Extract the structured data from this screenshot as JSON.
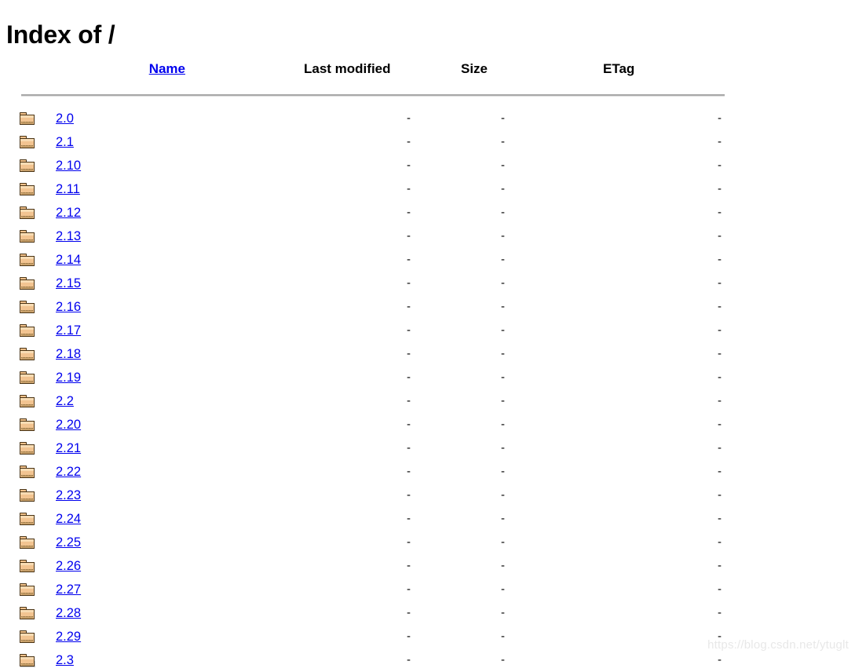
{
  "page": {
    "title": "Index of /",
    "watermark": "https://blog.csdn.net/ytuglt"
  },
  "table": {
    "headers": {
      "name": "Name",
      "last_modified": "Last modified",
      "size": "Size",
      "etag": "ETag"
    },
    "empty_value": "-",
    "rows": [
      {
        "icon": "folder-icon",
        "name": "2.0",
        "last_modified": "-",
        "size": "-",
        "etag": "-"
      },
      {
        "icon": "folder-icon",
        "name": "2.1",
        "last_modified": "-",
        "size": "-",
        "etag": "-"
      },
      {
        "icon": "folder-icon",
        "name": "2.10",
        "last_modified": "-",
        "size": "-",
        "etag": "-"
      },
      {
        "icon": "folder-icon",
        "name": "2.11",
        "last_modified": "-",
        "size": "-",
        "etag": "-"
      },
      {
        "icon": "folder-icon",
        "name": "2.12",
        "last_modified": "-",
        "size": "-",
        "etag": "-"
      },
      {
        "icon": "folder-icon",
        "name": "2.13",
        "last_modified": "-",
        "size": "-",
        "etag": "-"
      },
      {
        "icon": "folder-icon",
        "name": "2.14",
        "last_modified": "-",
        "size": "-",
        "etag": "-"
      },
      {
        "icon": "folder-icon",
        "name": "2.15",
        "last_modified": "-",
        "size": "-",
        "etag": "-"
      },
      {
        "icon": "folder-icon",
        "name": "2.16",
        "last_modified": "-",
        "size": "-",
        "etag": "-"
      },
      {
        "icon": "folder-icon",
        "name": "2.17",
        "last_modified": "-",
        "size": "-",
        "etag": "-"
      },
      {
        "icon": "folder-icon",
        "name": "2.18",
        "last_modified": "-",
        "size": "-",
        "etag": "-"
      },
      {
        "icon": "folder-icon",
        "name": "2.19",
        "last_modified": "-",
        "size": "-",
        "etag": "-"
      },
      {
        "icon": "folder-icon",
        "name": "2.2",
        "last_modified": "-",
        "size": "-",
        "etag": "-"
      },
      {
        "icon": "folder-icon",
        "name": "2.20",
        "last_modified": "-",
        "size": "-",
        "etag": "-"
      },
      {
        "icon": "folder-icon",
        "name": "2.21",
        "last_modified": "-",
        "size": "-",
        "etag": "-"
      },
      {
        "icon": "folder-icon",
        "name": "2.22",
        "last_modified": "-",
        "size": "-",
        "etag": "-"
      },
      {
        "icon": "folder-icon",
        "name": "2.23",
        "last_modified": "-",
        "size": "-",
        "etag": "-"
      },
      {
        "icon": "folder-icon",
        "name": "2.24",
        "last_modified": "-",
        "size": "-",
        "etag": "-"
      },
      {
        "icon": "folder-icon",
        "name": "2.25",
        "last_modified": "-",
        "size": "-",
        "etag": "-"
      },
      {
        "icon": "folder-icon",
        "name": "2.26",
        "last_modified": "-",
        "size": "-",
        "etag": "-"
      },
      {
        "icon": "folder-icon",
        "name": "2.27",
        "last_modified": "-",
        "size": "-",
        "etag": "-"
      },
      {
        "icon": "folder-icon",
        "name": "2.28",
        "last_modified": "-",
        "size": "-",
        "etag": "-"
      },
      {
        "icon": "folder-icon",
        "name": "2.29",
        "last_modified": "-",
        "size": "-",
        "etag": "-"
      },
      {
        "icon": "folder-icon",
        "name": "2.3",
        "last_modified": "-",
        "size": "-",
        "etag": "-"
      }
    ]
  },
  "colors": {
    "link": "#0000ee",
    "text": "#000000",
    "rule": "#a9a9a9",
    "folder_fill": "#f2c491",
    "folder_outline": "#4a3415",
    "watermark": "#e8e8e8"
  }
}
